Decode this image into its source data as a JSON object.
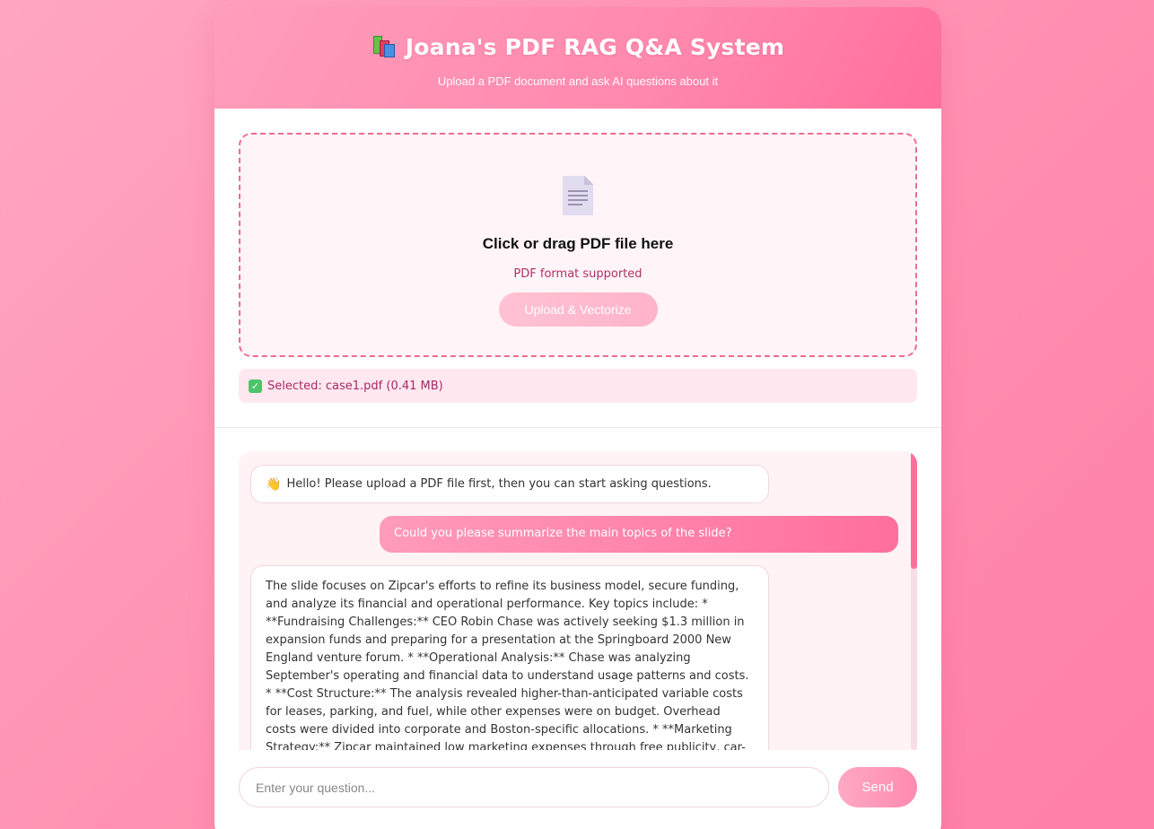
{
  "header": {
    "title": "Joana's PDF RAG Q&A System",
    "title_icon": "books-icon",
    "subtitle": "Upload a PDF document and ask AI questions about it"
  },
  "upload": {
    "icon": "document-icon",
    "title": "Click or drag PDF file here",
    "hint": "PDF format supported",
    "button_label": "Upload & Vectorize"
  },
  "selected_file": {
    "icon": "check-icon",
    "text": "Selected: case1.pdf (0.41 MB)"
  },
  "chat": {
    "greeting": "Hello! Please upload a PDF file first, then you can start asking questions.",
    "greeting_icon": "wave-icon",
    "user_question": "Could you please summarize the main topics of the slide?",
    "answer": "The slide focuses on Zipcar's efforts to refine its business model, secure funding, and analyze its financial and operational performance. Key topics include: * **Fundraising Challenges:** CEO Robin Chase was actively seeking $1.3 million in expansion funds and preparing for a presentation at the Springboard 2000 New England venture forum. * **Operational Analysis:** Chase was analyzing September's operating and financial data to understand usage patterns and costs. * **Cost Structure:** The analysis revealed higher-than-anticipated variable costs for leases, parking, and fuel, while other expenses were on budget. Overhead costs were divided into corporate and Boston-specific allocations. * **Marketing Strategy:** Zipcar maintained low marketing expenses through free publicity, car-generated advertising, brochures, and"
  },
  "input": {
    "placeholder": "Enter your question...",
    "send_label": "Send"
  },
  "colors": {
    "accent": "#ff6f9c",
    "background": "#ff8fb0",
    "dashed_border": "#f06a92"
  }
}
